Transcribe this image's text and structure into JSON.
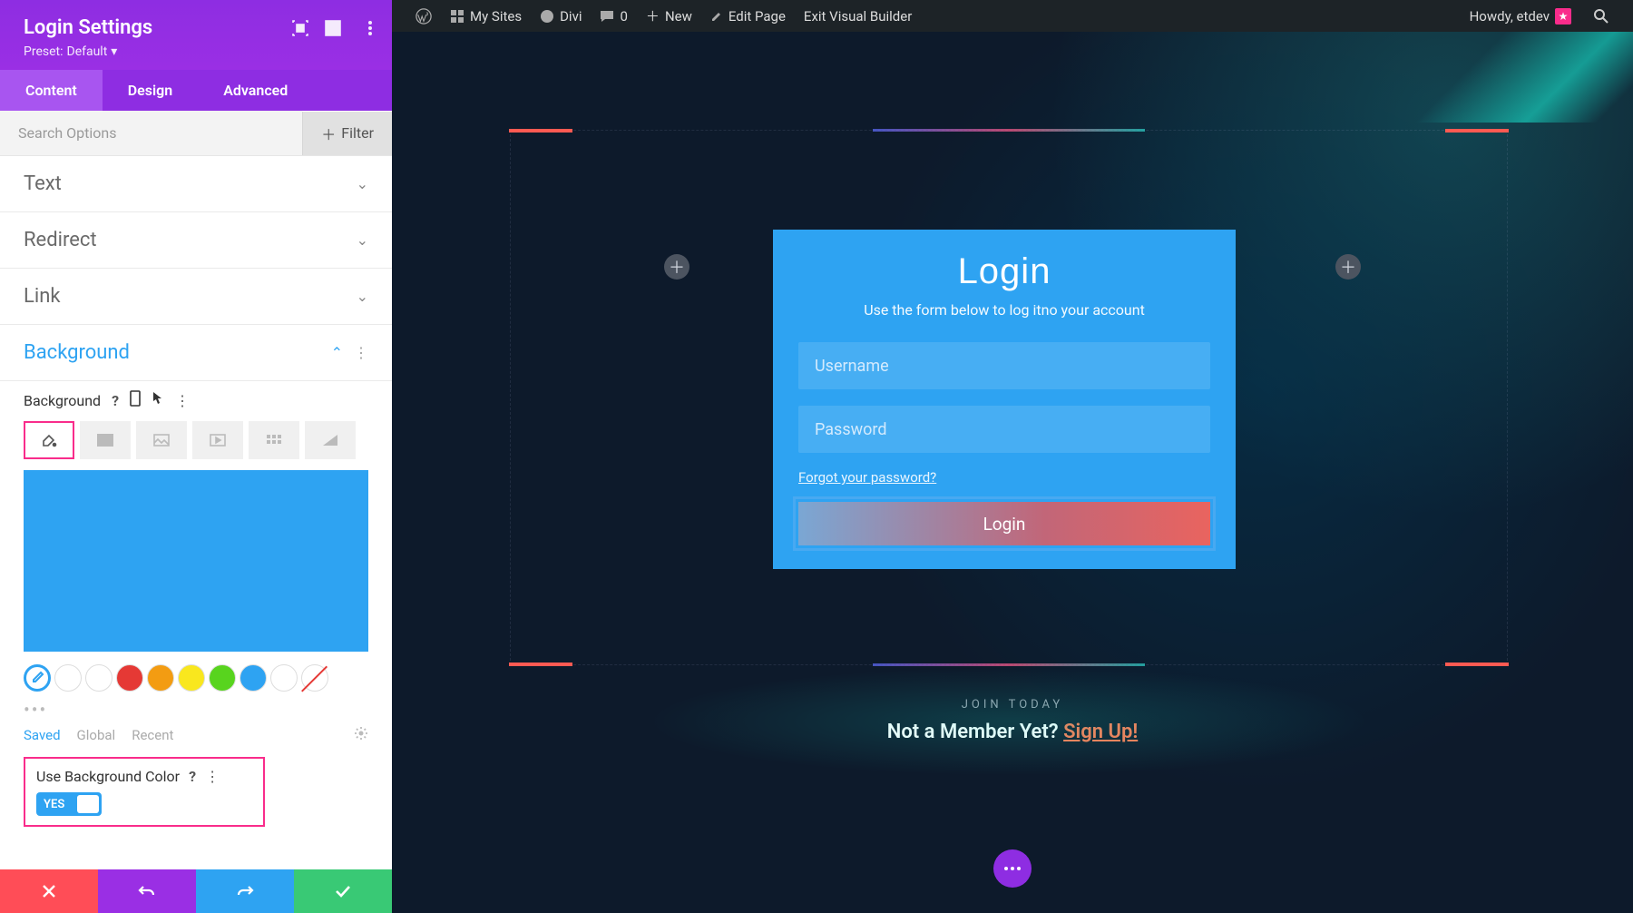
{
  "admin_bar": {
    "my_sites": "My Sites",
    "divi": "Divi",
    "comments": "0",
    "new": "New",
    "edit_page": "Edit Page",
    "exit_vb": "Exit Visual Builder",
    "howdy": "Howdy, etdev"
  },
  "panel": {
    "title": "Login Settings",
    "preset_label": "Preset:",
    "preset_value": "Default",
    "tabs": {
      "content": "Content",
      "design": "Design",
      "advanced": "Advanced"
    },
    "search_placeholder": "Search Options",
    "filter": "Filter",
    "sections": {
      "text": "Text",
      "redirect": "Redirect",
      "link": "Link",
      "background": "Background"
    },
    "bg_label": "Background",
    "palette": {
      "saved": "Saved",
      "global": "Global",
      "recent": "Recent"
    },
    "use_bg_label": "Use Background Color",
    "use_bg_value": "YES",
    "colors": {
      "preview": "#2ea3f2",
      "swatches": [
        "#ffffff",
        "#ffffff",
        "#e53935",
        "#f39c12",
        "#f9e71e",
        "#58d41e",
        "#2ea3f2",
        "#ffffff"
      ]
    }
  },
  "preview": {
    "login_title": "Login",
    "login_sub": "Use the form below to log itno your account",
    "ph_user": "Username",
    "ph_pass": "Password",
    "forgot": "Forgot your password?",
    "login_btn": "Login",
    "join_small": "Join Today",
    "join_big_prefix": "Not a Member Yet? ",
    "signup": "Sign Up!"
  }
}
